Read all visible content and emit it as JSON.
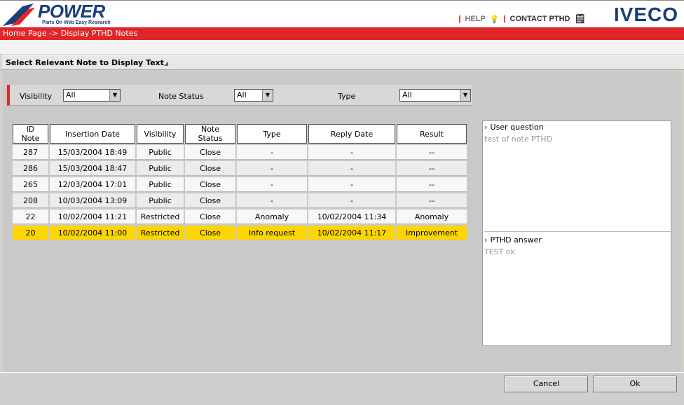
{
  "header": {
    "logo_text": "POWER",
    "logo_tagline": "Parts On Web Easy Research",
    "help_label": "HELP",
    "contact_label": "CONTACT PTHD",
    "brand": "IVECO"
  },
  "breadcrumb": "Home Page -> Display PTHD Notes",
  "section_title": "Select Relevant Note to Display Text",
  "filters": {
    "visibility_label": "Visibility",
    "visibility_value": "All",
    "status_label": "Note Status",
    "status_value": "All",
    "type_label": "Type",
    "type_value": "All"
  },
  "table": {
    "headers": [
      "ID Note",
      "Insertion Date",
      "Visibility",
      "Note Status",
      "Type",
      "Reply Date",
      "Result"
    ],
    "rows": [
      [
        "287",
        "15/03/2004 18:49",
        "Public",
        "Close",
        "-",
        "-",
        "--"
      ],
      [
        "286",
        "15/03/2004 18:47",
        "Public",
        "Close",
        "-",
        "-",
        "--"
      ],
      [
        "265",
        "12/03/2004 17:01",
        "Public",
        "Close",
        "-",
        "-",
        "--"
      ],
      [
        "208",
        "10/03/2004 13:09",
        "Public",
        "Close",
        "-",
        "-",
        "--"
      ],
      [
        "22",
        "10/02/2004 11:21",
        "Restricted",
        "Close",
        "Anomaly",
        "10/02/2004 11:34",
        "Anomaly"
      ],
      [
        "20",
        "10/02/2004 11:00",
        "Restricted",
        "Close",
        "Info request",
        "10/02/2004 11:17",
        "Improvement"
      ]
    ],
    "selected_row": 5
  },
  "details": {
    "question_label": "User question",
    "question_text": "test of note PTHD",
    "answer_label": "PTHD answer",
    "answer_text": "TEST ok"
  },
  "buttons": {
    "cancel": "Cancel",
    "ok": "Ok"
  }
}
